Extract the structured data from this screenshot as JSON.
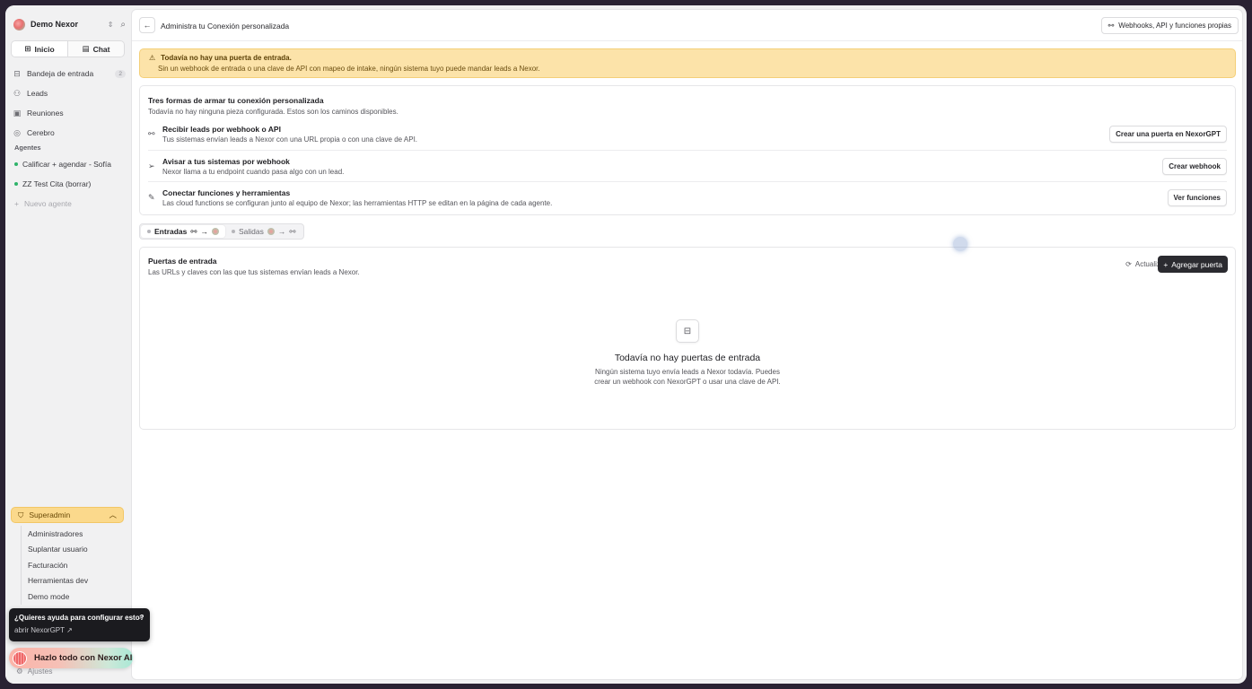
{
  "workspace": {
    "name": "Demo Nexor"
  },
  "sidebar": {
    "segments": [
      {
        "label": "Inicio",
        "icon": "grid-icon"
      },
      {
        "label": "Chat",
        "icon": "message-icon"
      }
    ],
    "nav": [
      {
        "label": "Bandeja de entrada",
        "icon": "inbox-icon",
        "badge": "2"
      },
      {
        "label": "Leads",
        "icon": "users-icon"
      },
      {
        "label": "Reuniones",
        "icon": "calendar-icon"
      },
      {
        "label": "Cerebro",
        "icon": "brain-icon"
      }
    ],
    "agents_label": "Agentes",
    "agents": [
      {
        "label": "Calificar + agendar - Sofía"
      },
      {
        "label": "ZZ Test Cita (borrar)"
      }
    ],
    "new_agent": "Nuevo agente",
    "superadmin": {
      "label": "Superadmin",
      "items": [
        "Administradores",
        "Suplantar usuario",
        "Facturación",
        "Herramientas dev",
        "Demo mode"
      ]
    },
    "ajustes": "Ajustes"
  },
  "help": {
    "question": "¿Quieres ayuda para configurar esto?",
    "link": "abrir NexorGPT ↗"
  },
  "ai_button": {
    "label": "Hazlo todo con Nexor AI"
  },
  "header": {
    "title": "Administra tu Conexión personalizada",
    "right_button": "Webhooks, API y funciones propias"
  },
  "alert": {
    "title": "Todavía no hay una puerta de entrada.",
    "subtitle": "Sin un webhook de entrada o una clave de API con mapeo de intake, ningún sistema tuyo puede mandar leads a Nexor."
  },
  "ways": {
    "title": "Tres formas de armar tu conexión personalizada",
    "subtitle": "Todavía no hay ninguna pieza configurada. Estos son los caminos disponibles.",
    "items": [
      {
        "title": "Recibir leads por webhook o API",
        "subtitle": "Tus sistemas envían leads a Nexor con una URL propia o con una clave de API.",
        "button": "Crear una puerta en NexorGPT",
        "icon": "webhook-icon"
      },
      {
        "title": "Avisar a tus sistemas por webhook",
        "subtitle": "Nexor llama a tu endpoint cuando pasa algo con un lead.",
        "button": "Crear webhook",
        "icon": "send-icon"
      },
      {
        "title": "Conectar funciones y herramientas",
        "subtitle": "Las cloud functions se configuran junto al equipo de Nexor; las herramientas HTTP se editan en la página de cada agente.",
        "button": "Ver funciones",
        "icon": "wrench-icon"
      }
    ]
  },
  "tabs": [
    {
      "label": "Entradas"
    },
    {
      "label": "Salidas"
    }
  ],
  "gates": {
    "title": "Puertas de entrada",
    "subtitle": "Las URLs y claves con las que tus sistemas envían leads a Nexor.",
    "refresh": "Actualizar",
    "add": "Agregar puerta",
    "empty_title": "Todavía no hay puertas de entrada",
    "empty_subtitle": "Ningún sistema tuyo envía leads a Nexor todavía. Puedes crear un webhook con NexorGPT o usar una clave de API."
  }
}
